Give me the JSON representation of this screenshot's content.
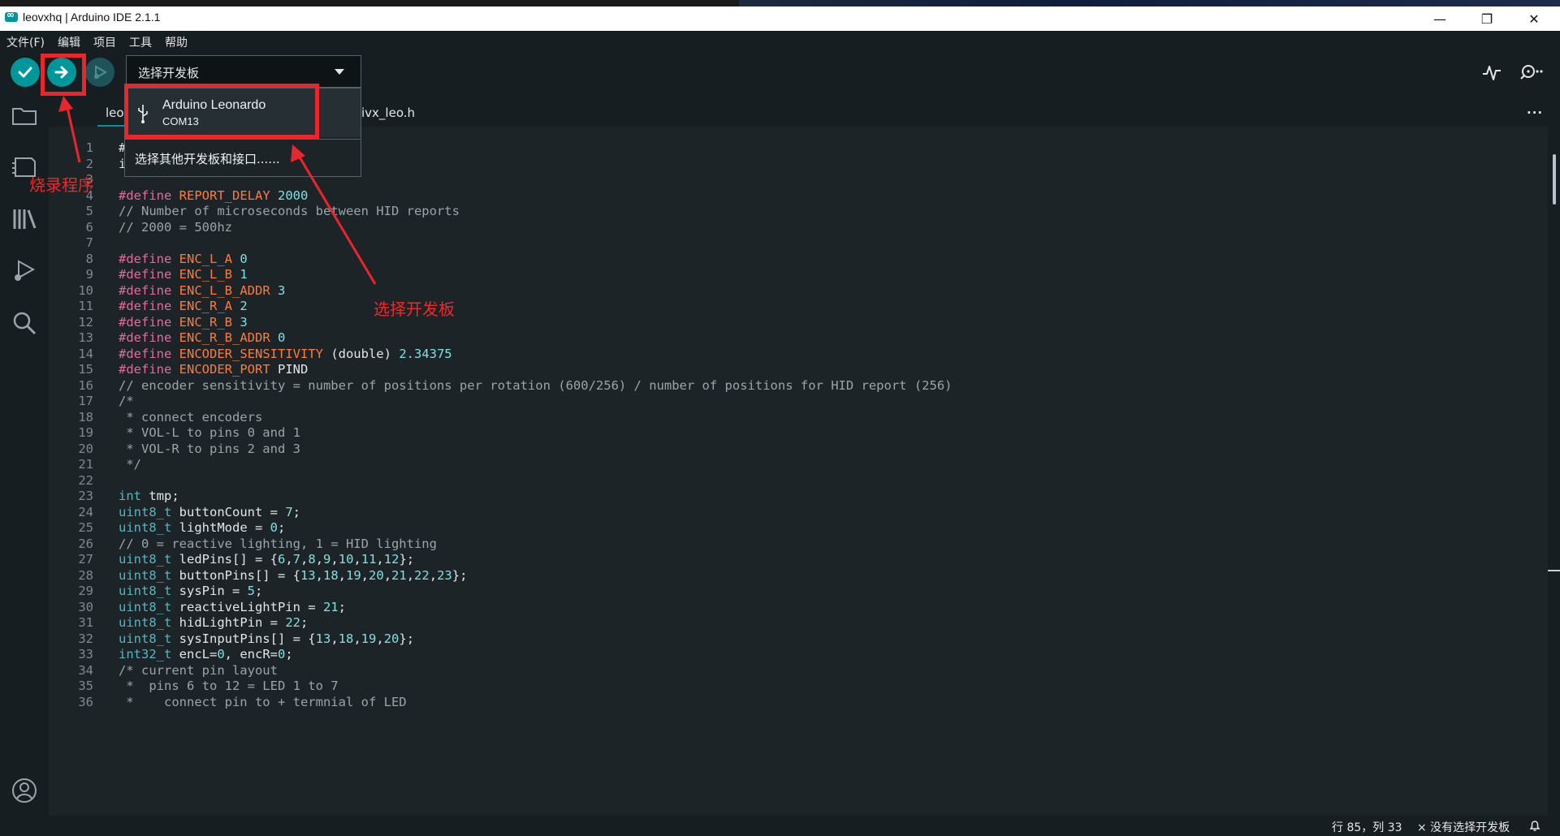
{
  "window": {
    "title": "leovxhq | Arduino IDE 2.1.1",
    "controls": [
      "minimize-icon",
      "restore-icon",
      "close-icon"
    ]
  },
  "menu": [
    "文件(F)",
    "编辑",
    "项目",
    "工具",
    "帮助"
  ],
  "toolbar": {
    "buttons": [
      "verify-icon",
      "upload-icon",
      "debug-icon"
    ],
    "board_select_label": "选择开发板",
    "right_icons": [
      "serial-plotter-icon",
      "serial-monitor-icon"
    ]
  },
  "board_dropdown": {
    "board_name": "Arduino Leonardo",
    "board_port": "COM13",
    "other_label": "选择其他开发板和接口......"
  },
  "sidebar_icons": [
    "sketchbook-folder-icon",
    "boards-manager-icon",
    "library-manager-icon",
    "debug-run-icon",
    "search-icon",
    "account-icon"
  ],
  "tabs": [
    {
      "label": "leovxhq.ino",
      "active": true
    },
    {
      "label": "ivx_leo.h",
      "active": false
    }
  ],
  "tab_more": "···",
  "editor": {
    "lines": [
      {
        "n": "1",
        "text": "#"
      },
      {
        "n": "2",
        "text": "i"
      },
      {
        "n": "3",
        "text": ""
      },
      {
        "n": "4",
        "text": "#define REPORT_DELAY 2000"
      },
      {
        "n": "5",
        "text": "// Number of microseconds between HID reports"
      },
      {
        "n": "6",
        "text": "// 2000 = 500hz"
      },
      {
        "n": "7",
        "text": ""
      },
      {
        "n": "8",
        "text": "#define ENC_L_A 0"
      },
      {
        "n": "9",
        "text": "#define ENC_L_B 1"
      },
      {
        "n": "10",
        "text": "#define ENC_L_B_ADDR 3"
      },
      {
        "n": "11",
        "text": "#define ENC_R_A 2"
      },
      {
        "n": "12",
        "text": "#define ENC_R_B 3"
      },
      {
        "n": "13",
        "text": "#define ENC_R_B_ADDR 0"
      },
      {
        "n": "14",
        "text": "#define ENCODER_SENSITIVITY (double) 2.34375"
      },
      {
        "n": "15",
        "text": "#define ENCODER_PORT PIND"
      },
      {
        "n": "16",
        "text": "// encoder sensitivity = number of positions per rotation (600/256) / number of positions for HID report (256)"
      },
      {
        "n": "17",
        "text": "/*"
      },
      {
        "n": "18",
        "text": " * connect encoders"
      },
      {
        "n": "19",
        "text": " * VOL-L to pins 0 and 1"
      },
      {
        "n": "20",
        "text": " * VOL-R to pins 2 and 3"
      },
      {
        "n": "21",
        "text": " */"
      },
      {
        "n": "22",
        "text": ""
      },
      {
        "n": "23",
        "text": "int tmp;"
      },
      {
        "n": "24",
        "text": "uint8_t buttonCount = 7;"
      },
      {
        "n": "25",
        "text": "uint8_t lightMode = 0;"
      },
      {
        "n": "26",
        "text": "// 0 = reactive lighting, 1 = HID lighting"
      },
      {
        "n": "27",
        "text": "uint8_t ledPins[] = {6,7,8,9,10,11,12};"
      },
      {
        "n": "28",
        "text": "uint8_t buttonPins[] = {13,18,19,20,21,22,23};"
      },
      {
        "n": "29",
        "text": "uint8_t sysPin = 5;"
      },
      {
        "n": "30",
        "text": "uint8_t reactiveLightPin = 21;"
      },
      {
        "n": "31",
        "text": "uint8_t hidLightPin = 22;"
      },
      {
        "n": "32",
        "text": "uint8_t sysInputPins[] = {13,18,19,20};"
      },
      {
        "n": "33",
        "text": "int32_t encL=0, encR=0;"
      },
      {
        "n": "34",
        "text": "/* current pin layout"
      },
      {
        "n": "35",
        "text": " *  pins 6 to 12 = LED 1 to 7"
      },
      {
        "n": "36",
        "text": " *    connect pin to + termnial of LED"
      }
    ]
  },
  "status": {
    "position": "行 85，列 33",
    "board": "× 没有选择开发板"
  },
  "annotations": {
    "upload_note": "烧录程序",
    "board_note": "选择开发板",
    "color": "#e8262b"
  },
  "colors": {
    "accent": "#00979c",
    "background": "#171e21",
    "editor_bg": "#1c2428"
  }
}
